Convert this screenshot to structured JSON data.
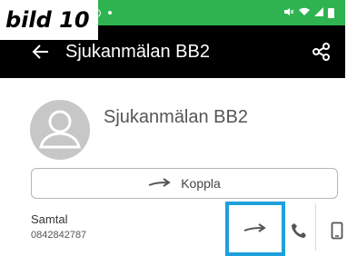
{
  "caption": "bild 10",
  "status_bar": {
    "left_icons": [
      "ring-icon",
      "dot-icon"
    ],
    "right_icons": [
      "mute-icon",
      "wifi-icon",
      "signal-icon",
      "battery-icon"
    ]
  },
  "app_bar": {
    "title": "Sjukanmälan BB2",
    "back_icon": "arrow-left-icon",
    "share_icon": "share-icon"
  },
  "contact": {
    "name": "Sjukanmälan BB2",
    "avatar_icon": "person-avatar-icon"
  },
  "koppla_button": {
    "label": "Koppla",
    "icon": "arrow-right-icon"
  },
  "number_row": {
    "label": "Samtal",
    "number": "0842842787",
    "actions": [
      "forward-icon",
      "phone-icon",
      "mobile-icon"
    ]
  },
  "colors": {
    "status_bar": "#2fb350",
    "app_bar": "#000000",
    "highlight": "#1ea0dc"
  }
}
